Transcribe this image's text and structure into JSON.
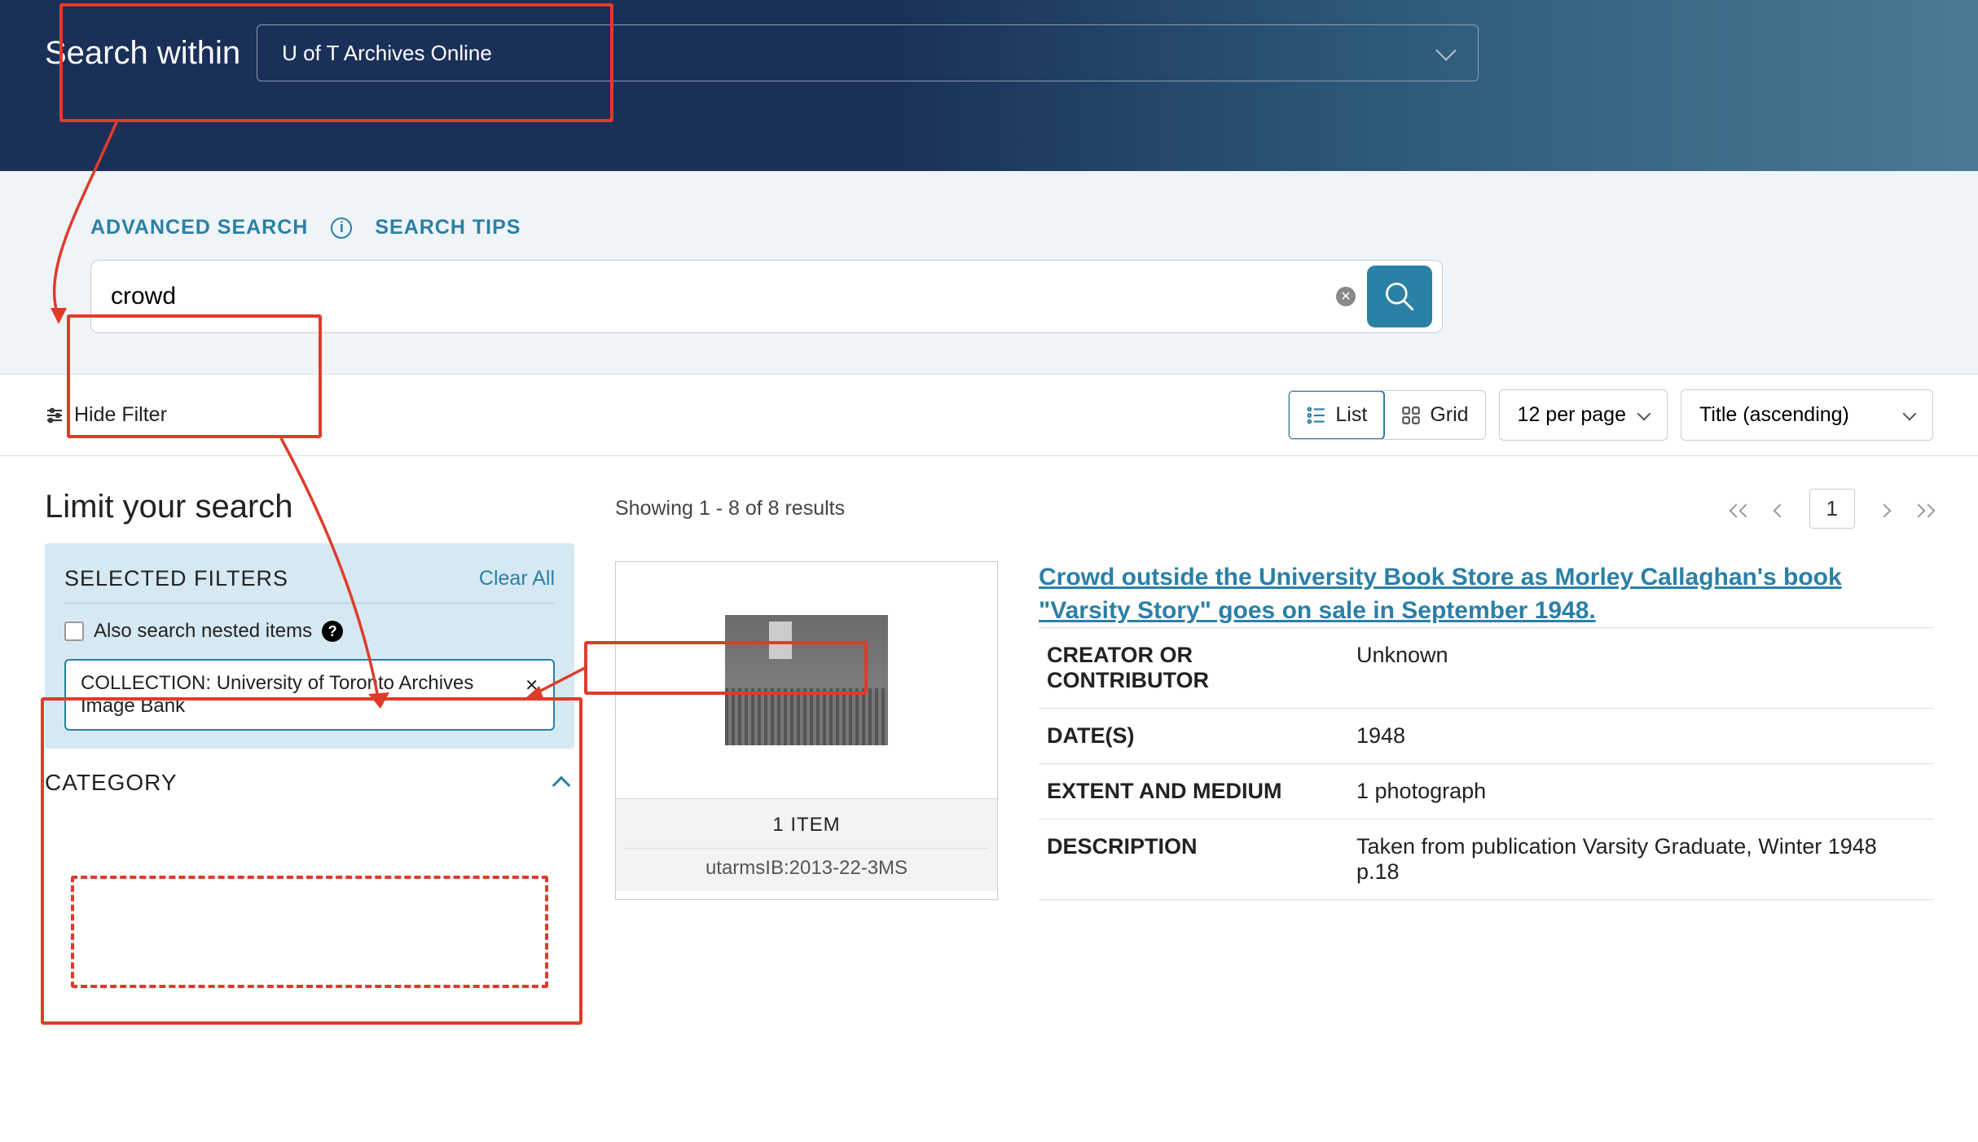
{
  "header": {
    "search_within_label": "Search within",
    "search_within_value": "U of T Archives Online"
  },
  "search": {
    "advanced_label": "ADVANCED SEARCH",
    "tips_label": "SEARCH TIPS",
    "query": "crowd"
  },
  "toolbar": {
    "hide_filter": "Hide Filter",
    "view_list": "List",
    "view_grid": "Grid",
    "per_page": "12 per page",
    "sort": "Title (ascending)"
  },
  "sidebar": {
    "limit_heading": "Limit your search",
    "selected_filters_label": "SELECTED FILTERS",
    "clear_all": "Clear All",
    "nested_label": "Also search nested items",
    "chip_text": "COLLECTION: University of Toronto Archives Image Bank",
    "category_label": "CATEGORY"
  },
  "results": {
    "showing": "Showing 1 - 8 of 8 results",
    "page": "1",
    "item": {
      "title": "Crowd outside the University Book Store as Morley Callaghan's book \"Varsity Story\" goes on sale in September 1948.",
      "items_label": "1 ITEM",
      "ref_id": "utarmsIB:2013-22-3MS",
      "creator_label": "CREATOR OR CONTRIBUTOR",
      "creator_value": "Unknown",
      "date_label": "DATE(S)",
      "date_value": "1948",
      "extent_label": "EXTENT AND MEDIUM",
      "extent_value": "1 photograph",
      "desc_label": "DESCRIPTION",
      "desc_value": "Taken from publication Varsity Graduate, Winter 1948 p.18"
    }
  }
}
